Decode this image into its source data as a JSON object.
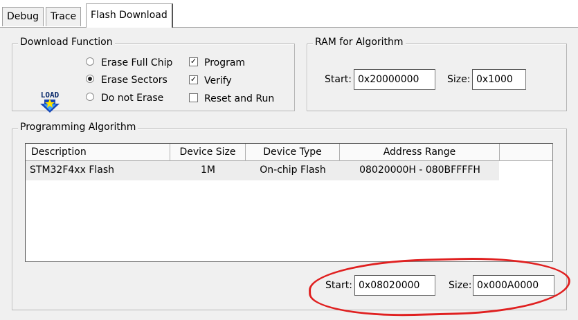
{
  "tabs": [
    {
      "label": "Debug"
    },
    {
      "label": "Trace"
    },
    {
      "label": "Flash Download",
      "active": true
    }
  ],
  "download_function": {
    "title": "Download Function",
    "icon": "load-icon",
    "icon_text": "LOAD",
    "erase_options": [
      {
        "label": "Erase Full Chip",
        "selected": false
      },
      {
        "label": "Erase Sectors",
        "selected": true
      },
      {
        "label": "Do not Erase",
        "selected": false
      }
    ],
    "checks": [
      {
        "label": "Program",
        "checked": true,
        "mark": "✓"
      },
      {
        "label": "Verify",
        "checked": true,
        "mark": "✓"
      },
      {
        "label": "Reset and Run",
        "checked": false,
        "mark": ""
      }
    ]
  },
  "ram": {
    "title": "RAM for Algorithm",
    "start_label": "Start:",
    "start_value": "0x20000000",
    "size_label": "Size:",
    "size_value": "0x1000"
  },
  "programming_algorithm": {
    "title": "Programming Algorithm",
    "columns": [
      "Description",
      "Device Size",
      "Device Type",
      "Address Range"
    ],
    "rows": [
      {
        "description": "STM32F4xx Flash",
        "device_size": "1M",
        "device_type": "On-chip Flash",
        "address_range": "08020000H - 080BFFFFH"
      }
    ],
    "start_label": "Start:",
    "start_value": "0x08020000",
    "size_label": "Size:",
    "size_value": "0x000A0000"
  },
  "colors": {
    "annotation": "#e02020",
    "panel_bg": "#f0f0f0"
  }
}
